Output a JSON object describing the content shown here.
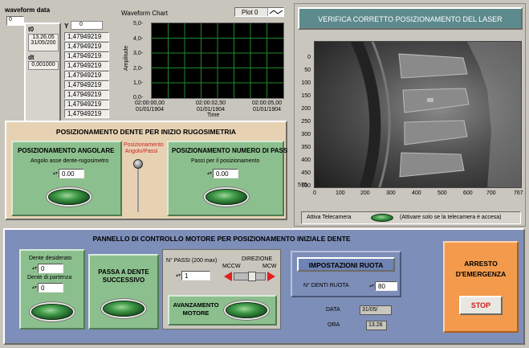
{
  "waveform_data": {
    "title": "waveform data",
    "t0_label": "t0",
    "t0_time": "13.26.05",
    "t0_date": "31/05/200",
    "dt_label": "dt",
    "dt_value": "0,001000",
    "y_label": "Y",
    "y_index": "0",
    "index_box": "0",
    "y_values": [
      "1,47949219",
      "1,47949219",
      "1,47949219",
      "1,47949219",
      "1,47949219",
      "1,47949219",
      "1,47949219",
      "1,47949219",
      "1,47949219"
    ]
  },
  "waveform_chart": {
    "title": "Waveform Chart",
    "plot_label": "Plot 0",
    "ylabel": "Amplitude",
    "xlabel": "Time",
    "yticks": [
      "5,0-",
      "4,0-",
      "3,0-",
      "2,0-",
      "1,0-",
      "0,0-"
    ],
    "xticks": [
      {
        "time": "02:00:00,00",
        "date": "01/01/1904"
      },
      {
        "time": "02:00:02,50",
        "date": "01/01/1904"
      },
      {
        "time": "02:00:05,00",
        "date": "01/01/1904"
      }
    ]
  },
  "camera": {
    "title": "VERIFICA CORRETTO POSIZIONAMENTO DEL LASER",
    "yticks": [
      "0",
      "50",
      "100",
      "150",
      "200",
      "250",
      "300",
      "350",
      "400",
      "450",
      "500",
      "575"
    ],
    "xticks": [
      "0",
      "100",
      "200",
      "300",
      "400",
      "500",
      "600",
      "700",
      "767"
    ],
    "enable_label": "Attiva Telecamera",
    "enable_hint": "(Attivare solo se la telecamera è accesa)"
  },
  "positioning": {
    "title": "POSIZIONAMENTO DENTE PER INIZIO RUGOSIMETRIA",
    "switch_label": "Posizionamento Angolo/Passi",
    "angular": {
      "title": "POSIZIONAMENTO ANGOLARE",
      "field_label": "Angolo asse dente-rugosimetro",
      "value": "0.00"
    },
    "steps": {
      "title": "POSIZIONAMENTO NUMERO DI PASS",
      "field_label": "Passi per il posizionamento",
      "value": "0.00"
    }
  },
  "motor_panel": {
    "title": "PANNELLO DI CONTROLLO MOTORE PER POSIZIONAMENTO INIZIALE DENTE",
    "desired_tooth_label": "Dente desiderato",
    "desired_tooth_value": "0",
    "start_tooth_label": "Dente di partenza",
    "start_tooth_value": "0",
    "next_tooth_label": "PASSA A DENTE SUCCESSIVO",
    "steps_label": "N° PASSI (200 max)",
    "steps_value": "1",
    "direction_label": "DIREZIONE",
    "mccw": "MCCW",
    "mcw": "MCW",
    "advance_label": "AVANZAMENTO MOTORE",
    "wheel_settings_title": "IMPOSTAZIONI RUOTA",
    "teeth_label": "N° DENTI RUOTA",
    "teeth_value": "80",
    "date_label": "DATA",
    "date_value": "31/05/",
    "time_label": "ORA",
    "time_value": "13.26"
  },
  "emergency": {
    "title": "ARRESTO D'EMERGENZA",
    "stop_label": "STOP"
  },
  "colors": {
    "background": "#c8c5bd",
    "green_panel": "#8cbf8e",
    "blue_panel": "#7d8eb8",
    "orange_panel": "#f39a4c",
    "chart_bg": "#000000",
    "chart_grid": "#1f8a2b",
    "camera_header": "#5d8a8c"
  }
}
